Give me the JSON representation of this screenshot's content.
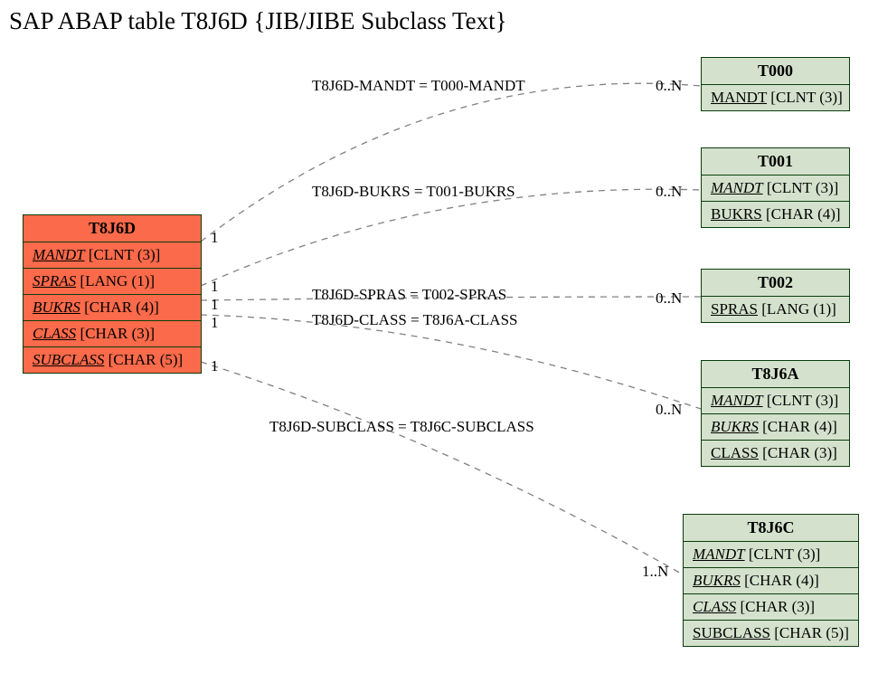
{
  "title": "SAP ABAP table T8J6D {JIB/JIBE Subclass Text}",
  "main": {
    "name": "T8J6D",
    "fields": [
      {
        "fname": "MANDT",
        "ftype": "[CLNT (3)]",
        "italic": true
      },
      {
        "fname": "SPRAS",
        "ftype": "[LANG (1)]",
        "italic": true
      },
      {
        "fname": "BUKRS",
        "ftype": "[CHAR (4)]",
        "italic": true
      },
      {
        "fname": "CLASS",
        "ftype": "[CHAR (3)]",
        "italic": true
      },
      {
        "fname": "SUBCLASS",
        "ftype": "[CHAR (5)]",
        "italic": true
      }
    ]
  },
  "refs": [
    {
      "name": "T000",
      "fields": [
        {
          "fname": "MANDT",
          "ftype": "[CLNT (3)]",
          "italic": false
        }
      ]
    },
    {
      "name": "T001",
      "fields": [
        {
          "fname": "MANDT",
          "ftype": "[CLNT (3)]",
          "italic": true
        },
        {
          "fname": "BUKRS",
          "ftype": "[CHAR (4)]",
          "italic": false
        }
      ]
    },
    {
      "name": "T002",
      "fields": [
        {
          "fname": "SPRAS",
          "ftype": "[LANG (1)]",
          "italic": false
        }
      ]
    },
    {
      "name": "T8J6A",
      "fields": [
        {
          "fname": "MANDT",
          "ftype": "[CLNT (3)]",
          "italic": true
        },
        {
          "fname": "BUKRS",
          "ftype": "[CHAR (4)]",
          "italic": true
        },
        {
          "fname": "CLASS",
          "ftype": "[CHAR (3)]",
          "italic": false
        }
      ]
    },
    {
      "name": "T8J6C",
      "fields": [
        {
          "fname": "MANDT",
          "ftype": "[CLNT (3)]",
          "italic": true
        },
        {
          "fname": "BUKRS",
          "ftype": "[CHAR (4)]",
          "italic": true
        },
        {
          "fname": "CLASS",
          "ftype": "[CHAR (3)]",
          "italic": true
        },
        {
          "fname": "SUBCLASS",
          "ftype": "[CHAR (5)]",
          "italic": false
        }
      ]
    }
  ],
  "links": [
    {
      "label": "T8J6D-MANDT = T000-MANDT",
      "left_card": "1",
      "right_card": "0..N"
    },
    {
      "label": "T8J6D-BUKRS = T001-BUKRS",
      "left_card": "1",
      "right_card": "0..N"
    },
    {
      "label": "T8J6D-SPRAS = T002-SPRAS",
      "left_card": "1",
      "right_card": "0..N"
    },
    {
      "label": "T8J6D-CLASS = T8J6A-CLASS",
      "left_card": "1",
      "right_card": "0..N"
    },
    {
      "label": "T8J6D-SUBCLASS = T8J6C-SUBCLASS",
      "left_card": "1",
      "right_card": "1..N"
    }
  ]
}
